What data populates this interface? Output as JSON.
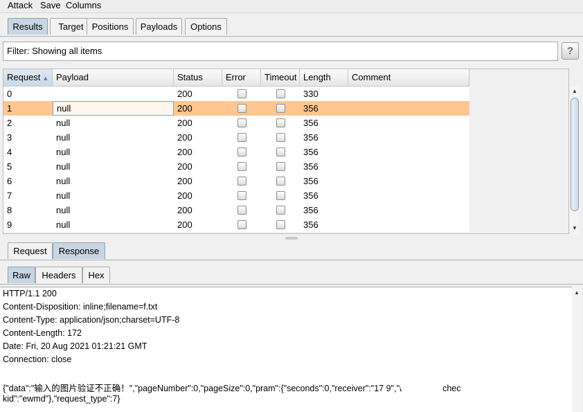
{
  "menu": {
    "attack": "Attack",
    "save": "Save",
    "columns": "Columns"
  },
  "main_tabs": {
    "results": "Results",
    "target": "Target",
    "positions": "Positions",
    "payloads": "Payloads",
    "options": "Options"
  },
  "filter": {
    "text": "Filter: Showing all items",
    "help": "?"
  },
  "table": {
    "headers": {
      "request": "Request",
      "payload": "Payload",
      "status": "Status",
      "error": "Error",
      "timeout": "Timeout",
      "length": "Length",
      "comment": "Comment"
    },
    "sort_indicator": "▲",
    "rows": [
      {
        "request": "0",
        "payload": "",
        "status": "200",
        "length": "330"
      },
      {
        "request": "1",
        "payload": "null",
        "status": "200",
        "length": "356"
      },
      {
        "request": "2",
        "payload": "null",
        "status": "200",
        "length": "356"
      },
      {
        "request": "3",
        "payload": "null",
        "status": "200",
        "length": "356"
      },
      {
        "request": "4",
        "payload": "null",
        "status": "200",
        "length": "356"
      },
      {
        "request": "5",
        "payload": "null",
        "status": "200",
        "length": "356"
      },
      {
        "request": "6",
        "payload": "null",
        "status": "200",
        "length": "356"
      },
      {
        "request": "7",
        "payload": "null",
        "status": "200",
        "length": "356"
      },
      {
        "request": "8",
        "payload": "null",
        "status": "200",
        "length": "356"
      },
      {
        "request": "9",
        "payload": "null",
        "status": "200",
        "length": "356"
      }
    ],
    "selected_row": 1
  },
  "message_tabs": {
    "request": "Request",
    "response": "Response"
  },
  "view_tabs": {
    "raw": "Raw",
    "headers": "Headers",
    "hex": "Hex"
  },
  "response_lines": {
    "l1": "HTTP/1.1 200",
    "l2": "Content-Disposition: inline;filename=f.txt",
    "l3": "Content-Type: application/json;charset=UTF-8",
    "l4": "Content-Length: 172",
    "l5": "Date: Fri, 20 Aug 2021 01:21:21 GMT",
    "l6": "Connection: close",
    "l8": "{\"data\":\"输入的图片验证不正确！\",\"pageNumber\":0,\"pageSize\":0,\"pram\":{\"seconds\":0,\"receiver\":\"17          9\",\"tel\":\"17            9\",\"chec",
    "l9": "kid\":\"ewmd\"},\"request_type\":7}"
  },
  "colors": {
    "selected_row": "#ffc690",
    "active_tab": "#c7d6e2",
    "accent": "#9fb3c4"
  }
}
